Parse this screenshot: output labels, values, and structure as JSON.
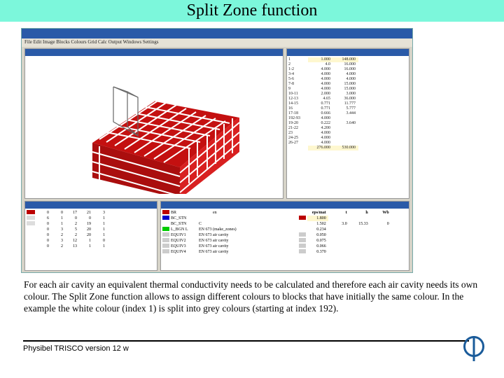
{
  "title": "Split Zone function",
  "menubar": "File  Edit  Image  Blocks  Colours  Grid  Calc  Output  Windows  Settings",
  "side_rows": [
    {
      "n": "1",
      "a": "1.000",
      "b": "148.000",
      "cr": true
    },
    {
      "n": "2",
      "a": "4.0",
      "b": "16.000"
    },
    {
      "n": "1-2",
      "a": "4.000",
      "b": "16.000"
    },
    {
      "n": "3-4",
      "a": "4.000",
      "b": "4.000"
    },
    {
      "n": "5-6",
      "a": "4.000",
      "b": "4.000"
    },
    {
      "n": "7-8",
      "a": "4.000",
      "b": "15.000"
    },
    {
      "n": "9",
      "a": "4.000",
      "b": "15.000"
    },
    {
      "n": "10-11",
      "a": "2.000",
      "b": "3.000"
    },
    {
      "n": "12-13",
      "a": "4.65",
      "b": "36.000"
    },
    {
      "n": "14-15",
      "a": "0.771",
      "b": "11.777"
    },
    {
      "n": "16",
      "a": "0.771",
      "b": "5.777"
    },
    {
      "n": "17-18",
      "a": "0.666",
      "b": "3.444"
    },
    {
      "n": "192-93",
      "a": "4.000",
      "b": ""
    },
    {
      "n": "19-20",
      "a": "0.222",
      "b": "3.640"
    },
    {
      "n": "21-22",
      "a": "4.200",
      "b": ""
    },
    {
      "n": "23",
      "a": "4.000",
      "b": ""
    },
    {
      "n": "24-25",
      "a": "4.000",
      "b": ""
    },
    {
      "n": "26-27",
      "a": "4.000",
      "b": ""
    },
    {
      "n": "",
      "a": "276.000",
      "b": "530.000",
      "cr": true
    }
  ],
  "brows": [
    {
      "col": "#b00",
      "v": [
        "0",
        "0",
        "17",
        "21",
        "3"
      ]
    },
    {
      "col": "#ddd",
      "v": [
        "6",
        "1",
        "0",
        "0",
        "1"
      ]
    },
    {
      "col": "#ddd",
      "v": [
        "0",
        "1",
        "2",
        "19",
        "1"
      ]
    },
    {
      "col": "#fff",
      "v": [
        "0",
        "3",
        "5",
        "20",
        "1"
      ]
    },
    {
      "col": "#fff",
      "v": [
        "0",
        "2",
        "2",
        "20",
        "1"
      ]
    },
    {
      "col": "#fff",
      "v": [
        "0",
        "3",
        "12",
        "1",
        "0"
      ]
    },
    {
      "col": "#fff",
      "v": [
        "0",
        "2",
        "13",
        "1",
        "1"
      ]
    }
  ],
  "crows": [
    {
      "col": "#b00",
      "l": "BR",
      "c": "",
      "d": "en"
    },
    {
      "col": "#00c",
      "l": "BC_STN",
      "c": "",
      "d": ""
    },
    {
      "col": "#fff",
      "l": "BC_STN",
      "c": "C",
      "d": ""
    },
    {
      "col": "#0c0",
      "l": "L_BGN L",
      "c": "EN 673",
      "d": "(make_zones)"
    },
    {
      "col": "#ccc",
      "l": "EQUIV1",
      "c": "EN 673",
      "d": "air cavity"
    },
    {
      "col": "#ccc",
      "l": "EQUIV2",
      "c": "EN 673",
      "d": "air cavity"
    },
    {
      "col": "#ccc",
      "l": "EQUIV3",
      "c": "EN 673",
      "d": "air cavity"
    },
    {
      "col": "#ccc",
      "l": "EQUIV4",
      "c": "EN 673",
      "d": "air cavity"
    }
  ],
  "right_header": [
    "eps/mat",
    "t",
    "h",
    "Wb"
  ],
  "rrows": [
    {
      "col": "#b00",
      "hi": true,
      "v": [
        "1.800",
        "",
        "",
        ""
      ]
    },
    {
      "col": "#fff",
      "v": [
        "1.502",
        "3.0",
        "15.33",
        "0"
      ]
    },
    {
      "col": "#fff",
      "v": [
        "0.234",
        "",
        "",
        ""
      ]
    },
    {
      "col": "#ccc",
      "v": [
        "0.050",
        "",
        "",
        ""
      ]
    },
    {
      "col": "#ccc",
      "v": [
        "0.075",
        "",
        "",
        ""
      ]
    },
    {
      "col": "#ccc",
      "v": [
        "0.066",
        "",
        "",
        ""
      ]
    },
    {
      "col": "#ccc",
      "v": [
        "0.370",
        "",
        "",
        ""
      ]
    }
  ],
  "desc": "For each air cavity an equivalent thermal conductivity needs to be calculated and therefore each air cavity needs its own colour.  The Split Zone function allows to assign different colours to blocks that have initially the same colour.  In the example the white colour (index 1) is split into grey colours (starting at index 192).",
  "footer": "Physibel TRISCO version 12 w"
}
